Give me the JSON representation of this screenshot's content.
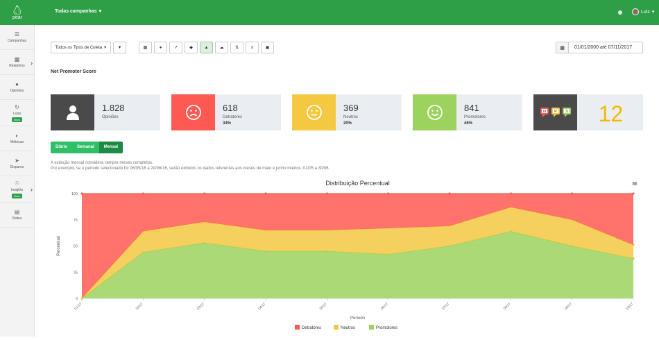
{
  "app": {
    "logo_text": "pear",
    "logo_icon": "pear-icon"
  },
  "topbar": {
    "campaign_label": "Todas campanhas",
    "user_name": "Luiz"
  },
  "sidebar": {
    "items": [
      {
        "label": "Campanhas",
        "icon": "list-icon"
      },
      {
        "label": "Relatórios",
        "icon": "bar-chart-icon"
      },
      {
        "label": "Opiniões",
        "icon": "chat-icon"
      },
      {
        "label": "Loop",
        "icon": "loop-icon",
        "badge": "Novo"
      },
      {
        "label": "Métricas",
        "icon": "metrics-icon"
      },
      {
        "label": "Disparos",
        "icon": "send-icon"
      },
      {
        "label": "Insights",
        "icon": "bulb-icon",
        "badge": "Novo"
      },
      {
        "label": "Status",
        "icon": "status-icon"
      }
    ]
  },
  "toolbar": {
    "collect_type": "Todos os Tipos de Coleta",
    "date_range": "01/01/2000 até 07/11/2017"
  },
  "page_title": "Net Promoter Score",
  "cards": [
    {
      "value": "1.828",
      "label": "Opiniões",
      "pct": ""
    },
    {
      "value": "618",
      "label": "Detratores",
      "pct": "34%"
    },
    {
      "value": "369",
      "label": "Neutros",
      "pct": "20%"
    },
    {
      "value": "841",
      "label": "Promotores",
      "pct": "46%"
    }
  ],
  "nps": {
    "value": "12",
    "badge_letters": [
      "N",
      "P",
      "S"
    ]
  },
  "period_toggle": [
    "Diário",
    "Semanal",
    "Mensal"
  ],
  "info": {
    "line1": "A exibição mensal considera sempre meses completos.",
    "line2": "Por exemplo, se o período selecionado for 06/05/16 a 20/06/16, serão exibidos os dados referentes aos meses de maio e junho inteiros: 01/05 a 30/06."
  },
  "colors": {
    "green": "#2e9e47",
    "red": "#ff5a52",
    "yellow": "#f5c842",
    "lightgreen": "#9cd25d",
    "dark": "#4a4a4a"
  },
  "chart_data": {
    "type": "area",
    "title": "Distribuição Percentual",
    "xlabel": "Período",
    "ylabel": "Percentual",
    "ylim": [
      0,
      100
    ],
    "yticks": [
      "0",
      "25",
      "50",
      "75",
      "100"
    ],
    "categories": [
      "01/17",
      "02/17",
      "03/17",
      "04/17",
      "05/17",
      "06/17",
      "07/17",
      "08/17",
      "09/17",
      "10/17"
    ],
    "stacked": true,
    "series": [
      {
        "name": "Promotores",
        "color": "#9cd25d",
        "values": [
          0,
          44,
          53,
          45,
          45,
          42,
          50,
          64,
          50,
          38
        ]
      },
      {
        "name": "Neutros",
        "color": "#f5c842",
        "values": [
          0,
          20,
          20,
          20,
          20,
          25,
          19,
          23,
          25,
          13
        ]
      },
      {
        "name": "Detratores",
        "color": "#ff5a52",
        "values": [
          100,
          36,
          27,
          35,
          35,
          33,
          31,
          13,
          25,
          49
        ]
      }
    ],
    "legend_order": [
      "Detratores",
      "Neutros",
      "Promotores"
    ],
    "legend": "bottom",
    "menu_icon": "hamburger-icon"
  }
}
